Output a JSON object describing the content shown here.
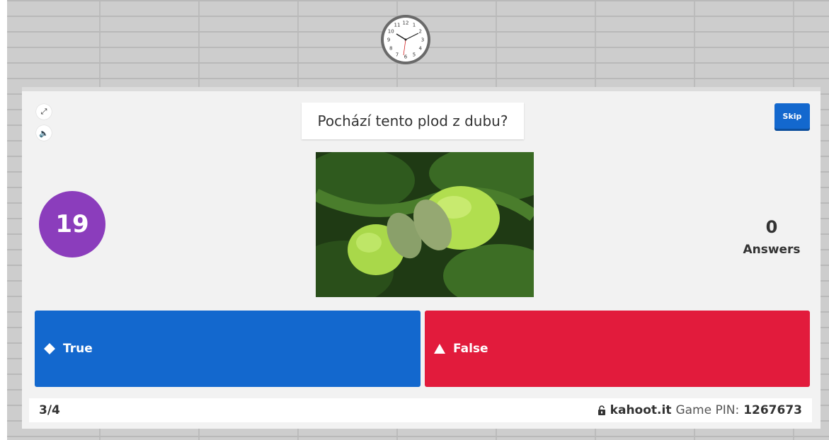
{
  "question": {
    "text": "Pochází tento plod z dubu?"
  },
  "controls": {
    "skip_label": "Skip"
  },
  "timer": {
    "seconds": "19"
  },
  "answers_panel": {
    "count": "0",
    "label": "Answers"
  },
  "choices": [
    {
      "label": "True",
      "shape": "diamond-icon",
      "color": "#1368ce"
    },
    {
      "label": "False",
      "shape": "triangle-icon",
      "color": "#e21b3c"
    }
  ],
  "footer": {
    "progress": "3/4",
    "site": "kahoot.it",
    "pin_label": "Game PIN:",
    "pin_value": "1267673"
  },
  "clock_numbers": [
    "12",
    "1",
    "2",
    "3",
    "4",
    "5",
    "6",
    "7",
    "8",
    "9",
    "10",
    "11"
  ],
  "colors": {
    "timer": "#8b3dbc",
    "skip": "#1368ce",
    "true": "#1368ce",
    "false": "#e21b3c"
  }
}
